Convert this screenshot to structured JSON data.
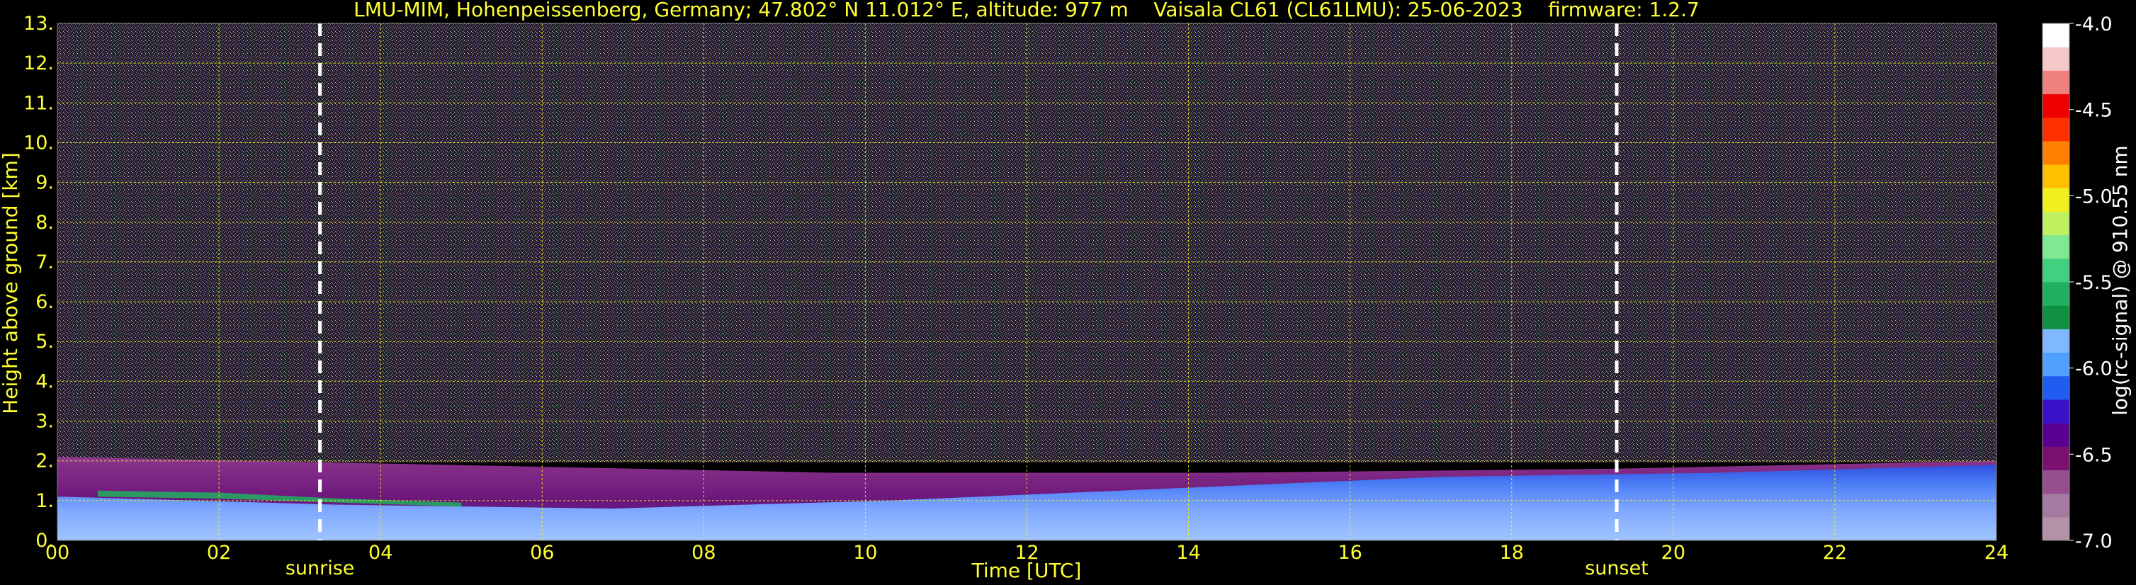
{
  "chart_data": {
    "type": "heatmap",
    "title": "LMU-MIM, Hohenpeissenberg, Germany; 47.802° N 11.012° E, altitude: 977 m    Vaisala CL61 (CL61LMU): 25-06-2023    firmware: 1.2.7",
    "xlabel": "Time [UTC]",
    "ylabel": "Height above ground [km]",
    "xlim": [
      0,
      24
    ],
    "ylim": [
      0,
      13
    ],
    "x_ticks": [
      "00",
      "02",
      "04",
      "06",
      "08",
      "10",
      "12",
      "14",
      "16",
      "18",
      "20",
      "22",
      "24"
    ],
    "x_tick_values": [
      0,
      2,
      4,
      6,
      8,
      10,
      12,
      14,
      16,
      18,
      20,
      22,
      24
    ],
    "y_ticks": [
      "0.",
      "1.",
      "2.",
      "3.",
      "4.",
      "5.",
      "6.",
      "7.",
      "8.",
      "9.",
      "10.",
      "11.",
      "12.",
      "13."
    ],
    "y_tick_values": [
      0,
      1,
      2,
      3,
      4,
      5,
      6,
      7,
      8,
      9,
      10,
      11,
      12,
      13
    ],
    "grid": true,
    "annotations": [
      {
        "label": "sunrise",
        "x": 3.25
      },
      {
        "label": "sunset",
        "x": 19.3
      }
    ],
    "colorbar": {
      "label": "log(rc-signal) @ 910.55 nm",
      "range": [
        -7.0,
        -4.0
      ],
      "ticks": [
        "-4.0",
        "-4.5",
        "-5.0",
        "-5.5",
        "-6.0",
        "-6.5",
        "-7.0"
      ],
      "tick_values": [
        -4.0,
        -4.5,
        -5.0,
        -5.5,
        -6.0,
        -6.5,
        -7.0
      ],
      "colors": [
        "#b392a8",
        "#a57aa0",
        "#954f90",
        "#7a1070",
        "#5a0090",
        "#3a10c8",
        "#1f5cf0",
        "#4fa0ff",
        "#7fb8ff",
        "#109040",
        "#20b060",
        "#40d080",
        "#80e890",
        "#c0f060",
        "#f0f020",
        "#ffc000",
        "#ff8000",
        "#ff3000",
        "#ee0000",
        "#f08080",
        "#f4c8c8",
        "#ffffff"
      ]
    },
    "layers": [
      {
        "type": "noise",
        "y_range": [
          2,
          13
        ]
      },
      {
        "type": "residual_layer",
        "x_range": [
          0,
          24
        ],
        "top_km": [
          2.1,
          1.9,
          1.7,
          1.7,
          1.8,
          2.0
        ]
      },
      {
        "type": "boundary_layer",
        "x_range": [
          0,
          24
        ],
        "top_km": [
          1.1,
          0.9,
          0.8,
          1.0,
          1.3,
          1.6,
          1.7,
          1.9
        ]
      }
    ]
  },
  "colors": {
    "background": "#000000",
    "text": "#ffff33",
    "grid": "#ffff00",
    "marker": "#ffffff"
  }
}
